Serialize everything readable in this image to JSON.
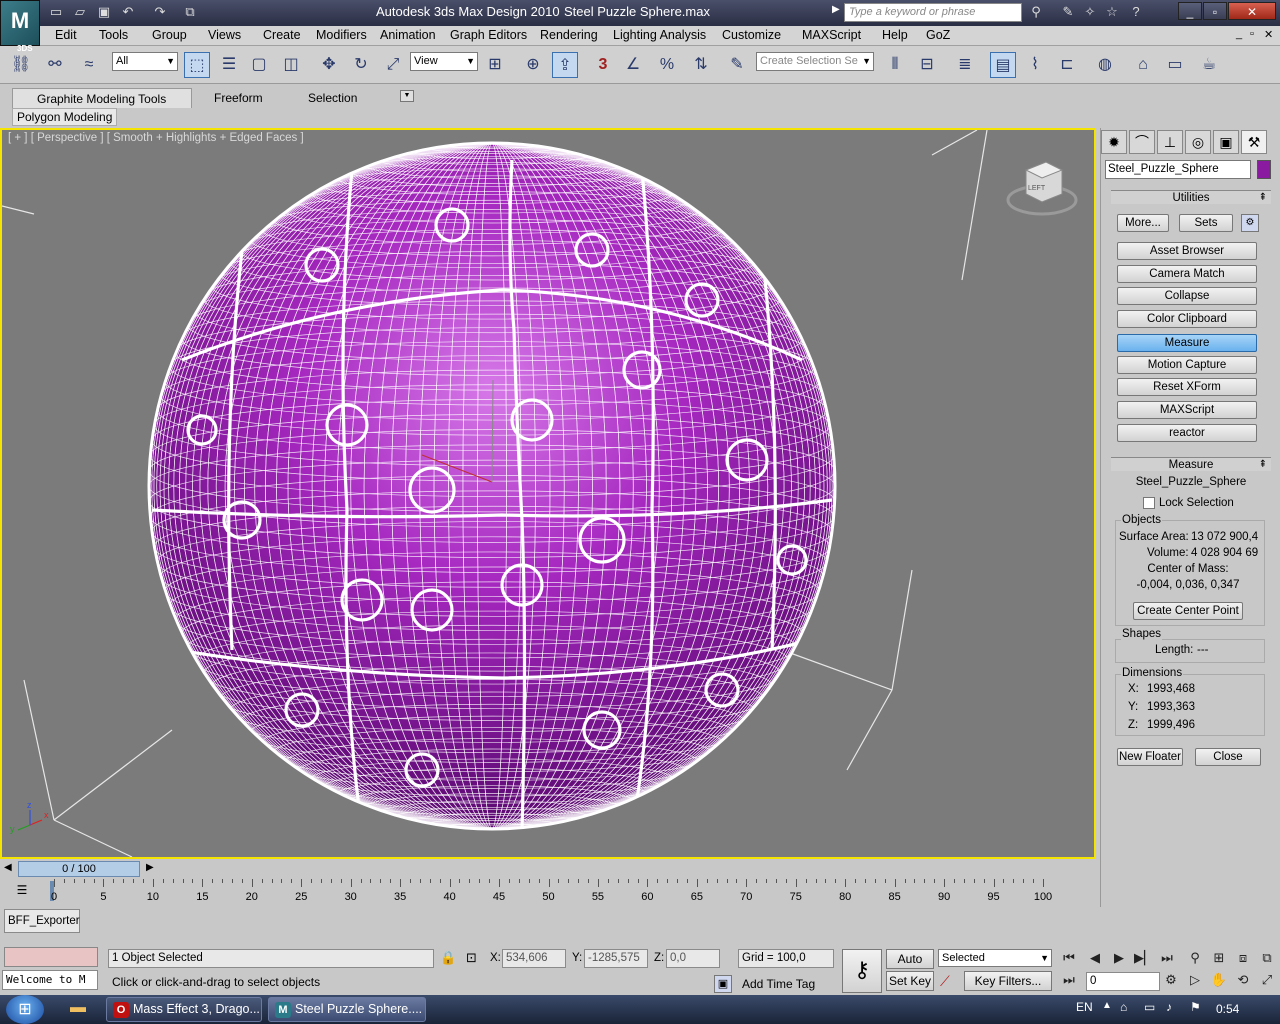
{
  "window": {
    "app_title": "Autodesk 3ds Max Design 2010",
    "file_title": "Steel Puzzle Sphere.max",
    "search_placeholder": "Type a keyword or phrase",
    "app_icon_label": "3DS"
  },
  "menu": [
    "Edit",
    "Tools",
    "Group",
    "Views",
    "Create",
    "Modifiers",
    "Animation",
    "Graph Editors",
    "Rendering",
    "Lighting Analysis",
    "Customize",
    "MAXScript",
    "Help",
    "GoZ"
  ],
  "toolbar": {
    "selection_filter": "All",
    "reference_coord": "View",
    "named_selection_placeholder": "Create Selection Se",
    "snap_label": "3"
  },
  "ribbon": {
    "tabs": [
      "Graphite Modeling Tools",
      "Freeform",
      "Selection"
    ],
    "panel_label": "Polygon Modeling"
  },
  "viewport": {
    "label": "[ + ] [ Perspective ] [ Smooth + Highlights + Edged Faces ]",
    "viewcube_label": "LEFT",
    "axis_labels": [
      "x",
      "y",
      "z"
    ]
  },
  "command_panel": {
    "object_name": "Steel_Puzzle_Sphere",
    "object_color": "#8a1aa0",
    "utilities_title": "Utilities",
    "more_label": "More...",
    "sets_label": "Sets",
    "utility_buttons": [
      "Asset Browser",
      "Camera Match",
      "Collapse",
      "Color Clipboard",
      "Measure",
      "Motion Capture",
      "Reset XForm",
      "MAXScript",
      "reactor"
    ],
    "active_utility": "Measure",
    "measure": {
      "title": "Measure",
      "object": "Steel_Puzzle_Sphere",
      "lock_selection_label": "Lock Selection",
      "objects_group": "Objects",
      "surface_area_label": "Surface Area:",
      "surface_area_value": "13 072 900,4!",
      "volume_label": "Volume:",
      "volume_value": "4 028 904 69!",
      "center_of_mass_label": "Center of Mass:",
      "center_of_mass_value": "-0,004, 0,036, 0,347",
      "create_center_point_label": "Create Center Point",
      "shapes_group": "Shapes",
      "length_label": "Length:",
      "length_value": "---",
      "dimensions_group": "Dimensions",
      "x_label": "X:",
      "x_value": "1993,468",
      "y_label": "Y:",
      "y_value": "1993,363",
      "z_label": "Z:",
      "z_value": "1999,496",
      "new_floater_label": "New Floater",
      "close_label": "Close"
    }
  },
  "timeline": {
    "frame_display": "0 / 100",
    "ticks": [
      "0",
      "5",
      "10",
      "15",
      "20",
      "25",
      "30",
      "35",
      "40",
      "45",
      "50",
      "55",
      "60",
      "65",
      "70",
      "75",
      "80",
      "85",
      "90",
      "95",
      "100"
    ]
  },
  "status": {
    "plugin_label": "BFF_Exporter",
    "listener_text": "Welcome to M",
    "selection_status": "1 Object Selected",
    "prompt": "Click or click-and-drag to select objects",
    "x_label": "X:",
    "x_value": "534,606",
    "y_label": "Y:",
    "y_value": "-1285,575",
    "z_label": "Z:",
    "z_value": "0,0",
    "grid": "Grid = 100,0",
    "add_time_tag": "Add Time Tag",
    "auto_key": "Auto Key",
    "set_key": "Set Key",
    "key_mode": "Selected",
    "key_filters": "Key Filters...",
    "current_frame": "0"
  },
  "taskbar": {
    "tasks": [
      "Mass Effect 3, Drago...",
      "Steel Puzzle Sphere...."
    ],
    "language": "EN",
    "clock": "0:54"
  }
}
